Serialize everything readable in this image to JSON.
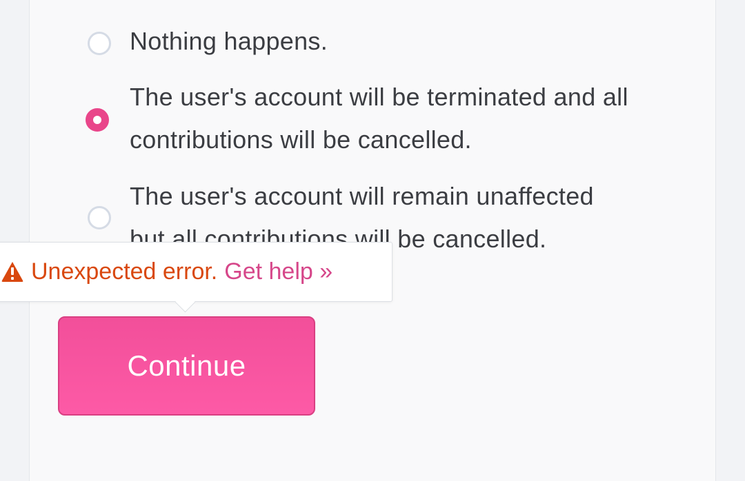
{
  "question": {
    "options": [
      {
        "label_lines": [
          "Nothing happens."
        ],
        "selected": false
      },
      {
        "label_lines": [
          "The user's account will be terminated and all",
          "contributions will be cancelled."
        ],
        "selected": true
      },
      {
        "label_lines": [
          "The user's account will remain unaffected",
          "but all contributions will be cancelled."
        ],
        "selected": false
      }
    ]
  },
  "tooltip": {
    "icon": "warning-triangle-icon",
    "error_text": "Unexpected error.",
    "help_link": "Get help »"
  },
  "continue_button": {
    "label": "Continue"
  },
  "colors": {
    "accent": "#e9468a",
    "button_fill": "#f853a0",
    "error": "#d9480f",
    "help_link": "#d6478a",
    "radio_border": "#d5dbe5"
  }
}
